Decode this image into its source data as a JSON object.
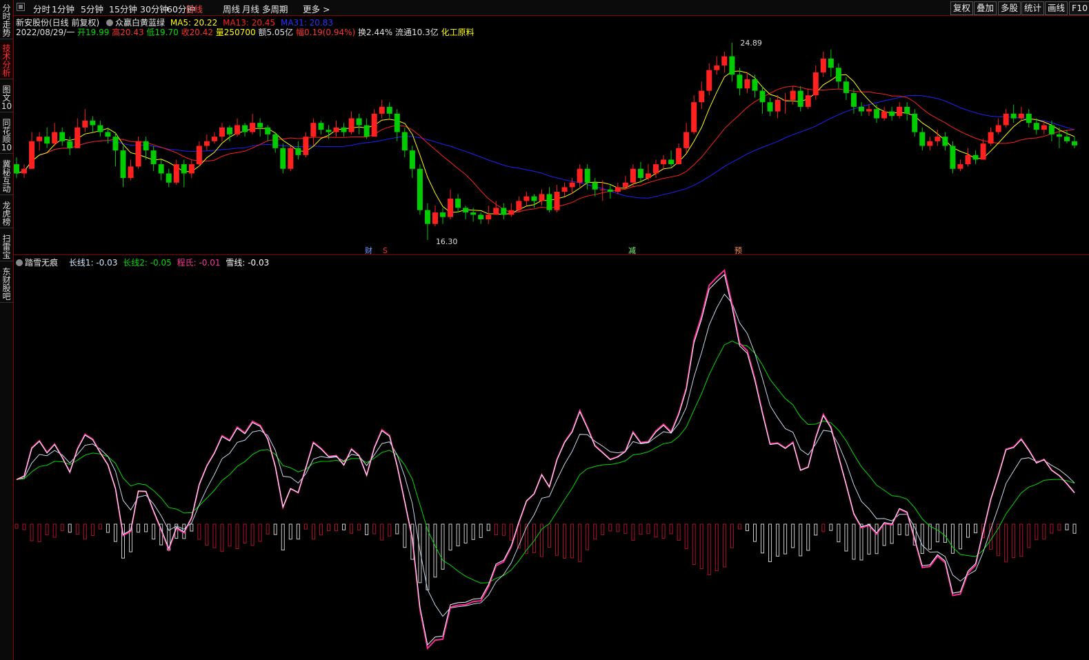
{
  "toolbar": {
    "items": [
      "分时",
      "1分钟",
      "5分钟",
      "15分钟",
      "30分钟",
      "60分钟",
      "日线",
      "周线",
      "月线",
      "多周期",
      "更多 >"
    ],
    "active": "日线",
    "right": [
      "复权",
      "叠加",
      "多股",
      "统计",
      "画线",
      "F10"
    ]
  },
  "side_tabs": [
    "分时走势",
    "技术分析",
    "图文10",
    "同花顺10",
    "冀秘互动",
    "龙虎榜",
    "扫雷宝",
    "东财股吧"
  ],
  "side_active": "技术分析",
  "info": {
    "stock_name": "新安股份(日线 前复权)",
    "indicator_name": "众赢白黄蓝绿",
    "ma5": "MA5: 20.22",
    "ma13": "MA13: 20.45",
    "ma31": "MA31: 20.83",
    "date": "2022/08/29/一",
    "open": "开19.99",
    "high": "高20.43",
    "low": "低19.70",
    "close": "收20.42",
    "volume": "量250700",
    "amount": "额5.05亿",
    "change": "幅0.19(0.94%)",
    "turnover": "换2.44%",
    "float": "流通10.3亿",
    "sector": "化工原料",
    "colors": {
      "ma5": "#ffff00",
      "ma13": "#ff2020",
      "ma31": "#2020ff",
      "up": "#ff2020",
      "down": "#00cc00",
      "accent": "#8b0000"
    }
  },
  "annotations": {
    "high_label": "24.89",
    "low_label": "16.30",
    "markers": [
      "财",
      "S",
      "减",
      "预"
    ]
  },
  "sub": {
    "name": "踏雪无痕",
    "long1": "长线1: -0.03",
    "long2": "长线2: -0.05",
    "cheng": "程氏: -0.01",
    "snow": "雪线: -0.03"
  },
  "chart_data": {
    "type": "candlestick",
    "price_range": [
      16.3,
      24.89
    ],
    "candles": [
      [
        19.6,
        19.2,
        19.9,
        19.0
      ],
      [
        19.2,
        19.4,
        19.6,
        19.0
      ],
      [
        19.4,
        20.6,
        21.0,
        19.4
      ],
      [
        20.6,
        20.8,
        21.0,
        20.2
      ],
      [
        20.8,
        20.5,
        21.2,
        20.3
      ],
      [
        20.5,
        21.0,
        21.4,
        20.4
      ],
      [
        21.0,
        20.6,
        21.2,
        20.4
      ],
      [
        20.6,
        20.3,
        20.8,
        20.0
      ],
      [
        20.3,
        21.2,
        21.6,
        20.3
      ],
      [
        21.2,
        21.5,
        22.0,
        21.0
      ],
      [
        21.5,
        21.3,
        21.7,
        21.0
      ],
      [
        21.3,
        21.0,
        21.5,
        20.8
      ],
      [
        21.0,
        20.8,
        21.2,
        20.5
      ],
      [
        20.8,
        20.2,
        21.0,
        19.5
      ],
      [
        20.2,
        19.0,
        20.4,
        18.6
      ],
      [
        19.0,
        19.5,
        19.8,
        18.9
      ],
      [
        19.5,
        20.6,
        20.8,
        19.4
      ],
      [
        20.6,
        20.2,
        20.8,
        19.8
      ],
      [
        20.2,
        19.6,
        20.4,
        19.3
      ],
      [
        19.6,
        19.2,
        19.8,
        18.9
      ],
      [
        19.2,
        18.8,
        19.4,
        18.6
      ],
      [
        18.8,
        19.6,
        19.8,
        18.7
      ],
      [
        19.6,
        19.2,
        19.8,
        18.6
      ],
      [
        19.2,
        19.6,
        19.8,
        19.0
      ],
      [
        19.6,
        20.4,
        20.6,
        19.5
      ],
      [
        20.4,
        20.6,
        20.9,
        20.2
      ],
      [
        20.6,
        20.8,
        21.0,
        20.5
      ],
      [
        20.8,
        21.2,
        21.4,
        20.6
      ],
      [
        21.2,
        20.9,
        21.3,
        20.6
      ],
      [
        20.9,
        21.3,
        21.6,
        20.8
      ],
      [
        21.3,
        21.0,
        21.4,
        20.8
      ],
      [
        21.0,
        21.4,
        21.8,
        20.9
      ],
      [
        21.4,
        21.2,
        21.6,
        20.8
      ],
      [
        21.2,
        20.9,
        21.3,
        20.6
      ],
      [
        20.9,
        20.3,
        21.0,
        20.1
      ],
      [
        20.3,
        19.4,
        20.5,
        19.2
      ],
      [
        19.4,
        20.3,
        20.4,
        19.3
      ],
      [
        20.3,
        20.0,
        20.6,
        19.8
      ],
      [
        20.0,
        20.8,
        21.0,
        19.9
      ],
      [
        20.8,
        21.4,
        21.6,
        20.4
      ],
      [
        21.4,
        21.1,
        21.5,
        20.9
      ],
      [
        21.1,
        21.0,
        21.3,
        20.7
      ],
      [
        21.0,
        21.2,
        21.5,
        20.8
      ],
      [
        21.2,
        21.0,
        21.4,
        20.8
      ],
      [
        21.0,
        21.6,
        21.9,
        20.9
      ],
      [
        21.6,
        21.3,
        21.8,
        20.9
      ],
      [
        21.3,
        20.8,
        21.6,
        20.7
      ],
      [
        20.8,
        21.8,
        22.0,
        20.8
      ],
      [
        21.8,
        22.1,
        22.4,
        21.6
      ],
      [
        22.1,
        21.8,
        22.3,
        21.6
      ],
      [
        21.8,
        21.0,
        22.0,
        20.6
      ],
      [
        21.0,
        20.2,
        21.2,
        19.9
      ],
      [
        20.2,
        19.4,
        20.4,
        19.0
      ],
      [
        19.4,
        17.6,
        19.6,
        17.4
      ],
      [
        17.6,
        17.0,
        17.9,
        16.3
      ],
      [
        17.0,
        17.5,
        17.8,
        16.9
      ],
      [
        17.5,
        17.3,
        17.7,
        17.0
      ],
      [
        17.3,
        18.1,
        18.5,
        17.2
      ],
      [
        18.1,
        17.7,
        18.3,
        17.5
      ],
      [
        17.7,
        17.5,
        17.8,
        17.2
      ],
      [
        17.5,
        17.4,
        17.7,
        17.1
      ],
      [
        17.4,
        17.2,
        17.5,
        17.0
      ],
      [
        17.2,
        17.4,
        17.8,
        17.0
      ],
      [
        17.4,
        17.7,
        18.0,
        17.4
      ],
      [
        17.7,
        17.4,
        17.9,
        17.2
      ],
      [
        17.4,
        17.6,
        17.9,
        17.3
      ],
      [
        17.6,
        18.0,
        18.2,
        17.5
      ],
      [
        18.0,
        18.2,
        18.4,
        17.8
      ],
      [
        18.2,
        18.0,
        18.3,
        17.7
      ],
      [
        18.0,
        18.3,
        18.5,
        17.8
      ],
      [
        18.3,
        17.6,
        18.6,
        17.5
      ],
      [
        17.6,
        18.4,
        18.7,
        17.5
      ],
      [
        18.4,
        18.6,
        18.8,
        18.2
      ],
      [
        18.6,
        18.8,
        19.0,
        18.3
      ],
      [
        18.8,
        19.4,
        19.6,
        18.6
      ],
      [
        19.4,
        18.8,
        19.6,
        18.5
      ],
      [
        18.8,
        18.5,
        19.0,
        18.2
      ],
      [
        18.5,
        18.5,
        18.9,
        18.0
      ],
      [
        18.5,
        18.4,
        18.7,
        18.1
      ],
      [
        18.4,
        18.6,
        18.8,
        18.3
      ],
      [
        18.6,
        18.8,
        19.1,
        18.5
      ],
      [
        18.8,
        19.4,
        19.6,
        18.6
      ],
      [
        19.4,
        19.0,
        19.7,
        18.8
      ],
      [
        19.0,
        19.2,
        19.6,
        18.9
      ],
      [
        19.2,
        19.6,
        19.8,
        19.0
      ],
      [
        19.6,
        19.8,
        20.0,
        19.4
      ],
      [
        19.8,
        19.6,
        20.2,
        19.5
      ],
      [
        19.6,
        20.3,
        20.5,
        19.6
      ],
      [
        20.3,
        21.0,
        21.4,
        20.1
      ],
      [
        21.0,
        22.3,
        22.6,
        20.9
      ],
      [
        22.3,
        22.8,
        23.2,
        22.0
      ],
      [
        22.8,
        23.7,
        24.0,
        22.6
      ],
      [
        23.7,
        23.9,
        24.3,
        23.5
      ],
      [
        23.9,
        24.3,
        24.5,
        23.6
      ],
      [
        24.3,
        23.5,
        24.89,
        23.2
      ],
      [
        23.5,
        22.9,
        23.8,
        22.6
      ],
      [
        22.9,
        23.3,
        23.6,
        22.7
      ],
      [
        23.3,
        22.8,
        23.5,
        22.5
      ],
      [
        22.8,
        22.3,
        23.0,
        21.8
      ],
      [
        22.3,
        21.9,
        22.5,
        21.7
      ],
      [
        21.9,
        22.4,
        22.6,
        21.6
      ],
      [
        22.4,
        22.4,
        22.7,
        21.8
      ],
      [
        22.4,
        22.8,
        23.0,
        22.2
      ],
      [
        22.8,
        22.1,
        23.0,
        21.9
      ],
      [
        22.1,
        22.6,
        22.9,
        22.0
      ],
      [
        22.6,
        23.6,
        23.9,
        22.4
      ],
      [
        23.6,
        24.2,
        24.5,
        23.4
      ],
      [
        24.2,
        23.8,
        24.6,
        23.4
      ],
      [
        23.8,
        23.2,
        24.0,
        22.9
      ],
      [
        23.2,
        22.7,
        23.4,
        22.4
      ],
      [
        22.7,
        22.1,
        22.9,
        21.8
      ],
      [
        22.1,
        21.9,
        22.3,
        21.7
      ],
      [
        21.9,
        22.0,
        22.2,
        21.7
      ],
      [
        22.0,
        21.6,
        22.2,
        21.4
      ],
      [
        21.6,
        21.9,
        22.1,
        21.5
      ],
      [
        21.9,
        21.7,
        22.1,
        21.5
      ],
      [
        21.7,
        22.1,
        22.3,
        21.6
      ],
      [
        22.1,
        21.8,
        22.3,
        21.5
      ],
      [
        21.8,
        21.0,
        22.0,
        20.8
      ],
      [
        21.0,
        20.4,
        21.2,
        20.2
      ],
      [
        20.4,
        20.6,
        20.8,
        20.2
      ],
      [
        20.6,
        20.8,
        21.1,
        20.4
      ],
      [
        20.8,
        20.4,
        21.0,
        20.2
      ],
      [
        20.4,
        19.4,
        20.6,
        19.2
      ],
      [
        19.4,
        19.6,
        19.8,
        19.3
      ],
      [
        19.6,
        20.0,
        20.3,
        19.5
      ],
      [
        20.0,
        19.8,
        20.2,
        19.6
      ],
      [
        19.8,
        20.5,
        20.7,
        19.8
      ],
      [
        20.5,
        21.0,
        21.2,
        20.4
      ],
      [
        21.0,
        21.3,
        21.6,
        20.9
      ],
      [
        21.3,
        21.8,
        22.0,
        21.2
      ],
      [
        21.8,
        21.6,
        22.2,
        21.4
      ],
      [
        21.6,
        21.8,
        22.1,
        21.5
      ],
      [
        21.8,
        21.4,
        22.0,
        21.2
      ],
      [
        21.4,
        21.1,
        21.6,
        20.9
      ],
      [
        21.1,
        21.3,
        21.5,
        20.9
      ],
      [
        21.3,
        20.9,
        21.5,
        20.6
      ],
      [
        20.9,
        20.8,
        21.2,
        20.3
      ],
      [
        20.8,
        20.6,
        21.1,
        20.5
      ],
      [
        20.6,
        20.42,
        20.8,
        20.3
      ]
    ]
  }
}
